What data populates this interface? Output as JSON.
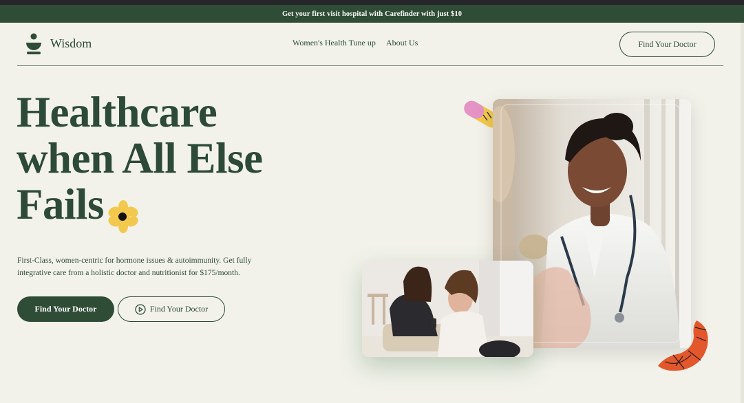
{
  "promo": {
    "text": "Get your first visit hospital with Carefinder with just $10"
  },
  "brand": {
    "name": "Wisdom",
    "logo_icon": "wisdom-logo-icon"
  },
  "nav": {
    "links": [
      {
        "label": "Women's Health Tune up"
      },
      {
        "label": "About Us"
      }
    ],
    "cta_label": "Find Your Doctor"
  },
  "hero": {
    "title_lines": [
      "Healthcare",
      "when All Else",
      "Fails"
    ],
    "description_line1": "First-Class, women-centric for hormone issues & autoimmunity. Get fully",
    "description_line2": "integrative care from a holistic doctor and nutritionist for $175/month.",
    "primary_button": "Find Your Doctor",
    "secondary_button": "Find Your Doctor",
    "secondary_icon": "play-circle-icon"
  },
  "images": {
    "doctor": "smiling-doctor-photo",
    "kids": "two-girls-with-phone-photo"
  },
  "colors": {
    "brand_green": "#2f4c36",
    "text_green": "#2c4a37",
    "background": "#f2f2ea",
    "flower_yellow": "#f2c94c",
    "pill_pink": "#e593c4",
    "worm_orange": "#e2582c"
  }
}
